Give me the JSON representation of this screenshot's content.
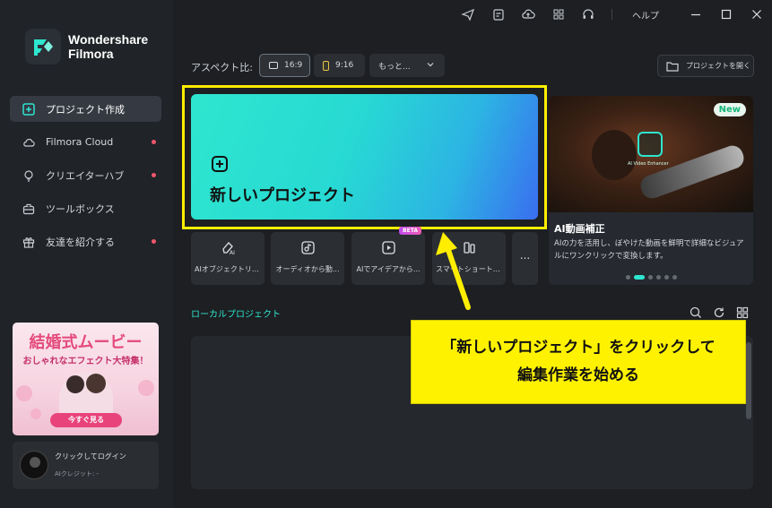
{
  "app": {
    "brand_line1": "Wondershare",
    "brand_line2": "Filmora"
  },
  "titlebar": {
    "help_label": "ヘルプ",
    "icons": [
      "send-icon",
      "clipboard-icon",
      "cloud-upload-icon",
      "grid-icon",
      "headset-icon",
      "minimize-icon",
      "maximize-icon",
      "close-icon"
    ]
  },
  "sidebar": {
    "items": [
      {
        "label": "プロジェクト作成",
        "icon": "new-project-icon",
        "active": true,
        "dot": false
      },
      {
        "label": "Filmora Cloud",
        "icon": "cloud-icon",
        "active": false,
        "dot": true
      },
      {
        "label": "クリエイターハブ",
        "icon": "bulb-icon",
        "active": false,
        "dot": true
      },
      {
        "label": "ツールボックス",
        "icon": "toolbox-icon",
        "active": false,
        "dot": false
      },
      {
        "label": "友達を紹介する",
        "icon": "gift-icon",
        "active": false,
        "dot": true
      }
    ],
    "promo": {
      "title": "結婚式ムービー",
      "subtitle": "おしゃれなエフェクト大特集！",
      "button": "今すぐ見る"
    },
    "login": {
      "line1": "クリックしてログイン",
      "line2": "AIクレジット: -"
    }
  },
  "toolbar": {
    "aspect_label": "アスペクト比:",
    "ratio_169": "16:9",
    "ratio_916": "9:16",
    "more": "もっと...",
    "open_project": "プロジェクトを開く"
  },
  "new_project": {
    "label": "新しいプロジェクト"
  },
  "banner": {
    "badge": "New",
    "image_caption": "AI Video Enhancer",
    "title": "AI動画補正",
    "description": "AIの力を活用し、ぼやけた動画を鮮明で詳細なビジュアルにワンクリックで変換します。",
    "page_count": 6,
    "current_page": 2
  },
  "tools": [
    {
      "label": "AIオブジェクトリム...",
      "icon": "eraser-ai-icon",
      "beta": ""
    },
    {
      "label": "オーディオから動...",
      "icon": "audio-to-video-icon",
      "beta": ""
    },
    {
      "label": "AIでアイデアから...",
      "icon": "idea-to-video-icon",
      "beta": "BETA"
    },
    {
      "label": "スマートショートク...",
      "icon": "smart-short-clip-icon",
      "beta": ""
    }
  ],
  "more_label": "...",
  "local": {
    "title": "ローカルプロジェクト"
  },
  "callout": {
    "line1": "「新しいプロジェクト」をクリックして",
    "line2": "編集作業を始める"
  },
  "colors": {
    "accent": "#2ee6cf",
    "highlight": "#ffee00",
    "callout_bg": "#fff200",
    "notify_dot": "#f0566a"
  }
}
